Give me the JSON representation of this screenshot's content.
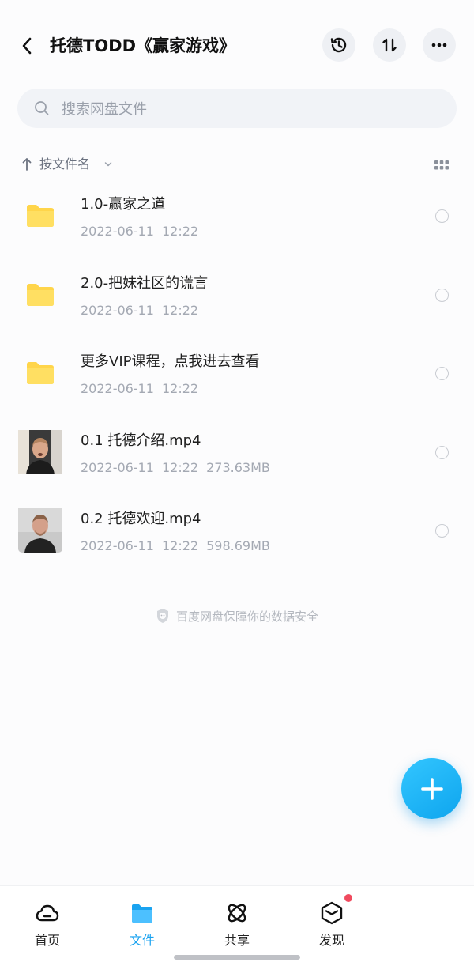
{
  "header": {
    "title": "托德TODD《赢家游戏》"
  },
  "search": {
    "placeholder": "搜索网盘文件"
  },
  "sort": {
    "label": "按文件名"
  },
  "files": [
    {
      "name": "1.0-赢家之道",
      "date": "2022-06-11",
      "time": "12:22",
      "size": "",
      "type": "folder"
    },
    {
      "name": "2.0-把妹社区的谎言",
      "date": "2022-06-11",
      "time": "12:22",
      "size": "",
      "type": "folder"
    },
    {
      "name": "更多VIP课程，点我进去查看",
      "date": "2022-06-11",
      "time": "12:22",
      "size": "",
      "type": "folder"
    },
    {
      "name": "0.1 托德介绍.mp4",
      "date": "2022-06-11",
      "time": "12:22",
      "size": "273.63MB",
      "type": "video"
    },
    {
      "name": "0.2 托德欢迎.mp4",
      "date": "2022-06-11",
      "time": "12:22",
      "size": "598.69MB",
      "type": "video"
    }
  ],
  "footer": {
    "safe_text": "百度网盘保障你的数据安全"
  },
  "tabs": [
    {
      "label": "首页",
      "icon": "cloud-icon"
    },
    {
      "label": "文件",
      "icon": "folder-icon"
    },
    {
      "label": "共享",
      "icon": "atom-icon"
    },
    {
      "label": "发现",
      "icon": "cube-icon"
    }
  ],
  "colors": {
    "accent": "#1aa3f0",
    "folder": "#ffd54a",
    "badge": "#f04a5e"
  }
}
